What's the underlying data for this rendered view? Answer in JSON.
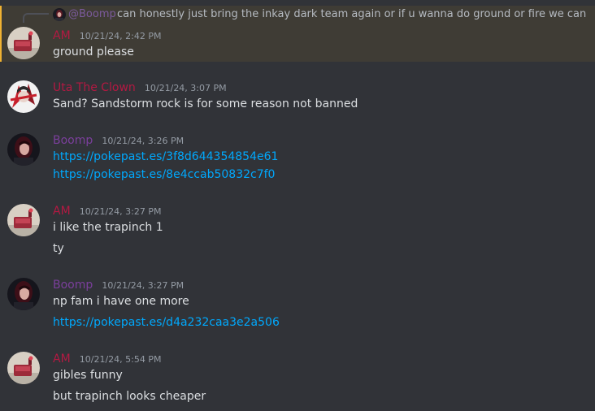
{
  "colors": {
    "background": "#313338",
    "highlight_bg": "#3f3c35",
    "highlight_bar": "#f0b232",
    "am": "#b31942",
    "uta": "#b31942",
    "boomp": "#7b3f9c",
    "link": "#00a8fc"
  },
  "reply": {
    "mention": "@Boomp",
    "text": "can honestly just bring the inkay dark team again or if u wanna do ground or fire we can",
    "avatar_icon": "boomp-avatar"
  },
  "messages": [
    {
      "author": "AM",
      "timestamp": "10/21/24, 2:42 PM",
      "avatar_icon": "am-avatar",
      "lines": [
        {
          "text": "ground please",
          "link": false
        }
      ]
    },
    {
      "author": "Uta The Clown",
      "timestamp": "10/21/24, 3:07 PM",
      "avatar_icon": "uta-avatar",
      "lines": [
        {
          "text": "Sand? Sandstorm rock is for some reason not banned",
          "link": false
        }
      ]
    },
    {
      "author": "Boomp",
      "timestamp": "10/21/24, 3:26 PM",
      "avatar_icon": "boomp-avatar",
      "lines": [
        {
          "text": "https://pokepast.es/3f8d644354854e61",
          "link": true
        },
        {
          "text": "https://pokepast.es/8e4ccab50832c7f0",
          "link": true
        }
      ]
    },
    {
      "author": "AM",
      "timestamp": "10/21/24, 3:27 PM",
      "avatar_icon": "am-avatar",
      "lines": [
        {
          "text": "i like the trapinch 1",
          "link": false
        },
        {
          "text": "ty",
          "link": false
        }
      ]
    },
    {
      "author": "Boomp",
      "timestamp": "10/21/24, 3:27 PM",
      "avatar_icon": "boomp-avatar",
      "lines": [
        {
          "text": "np fam i have one more",
          "link": false
        },
        {
          "text": "https://pokepast.es/d4a232caa3e2a506",
          "link": true
        }
      ]
    },
    {
      "author": "AM",
      "timestamp": "10/21/24, 5:54 PM",
      "avatar_icon": "am-avatar",
      "lines": [
        {
          "text": "gibles funny",
          "link": false
        },
        {
          "text": "but trapinch looks cheaper",
          "link": false
        }
      ]
    }
  ]
}
